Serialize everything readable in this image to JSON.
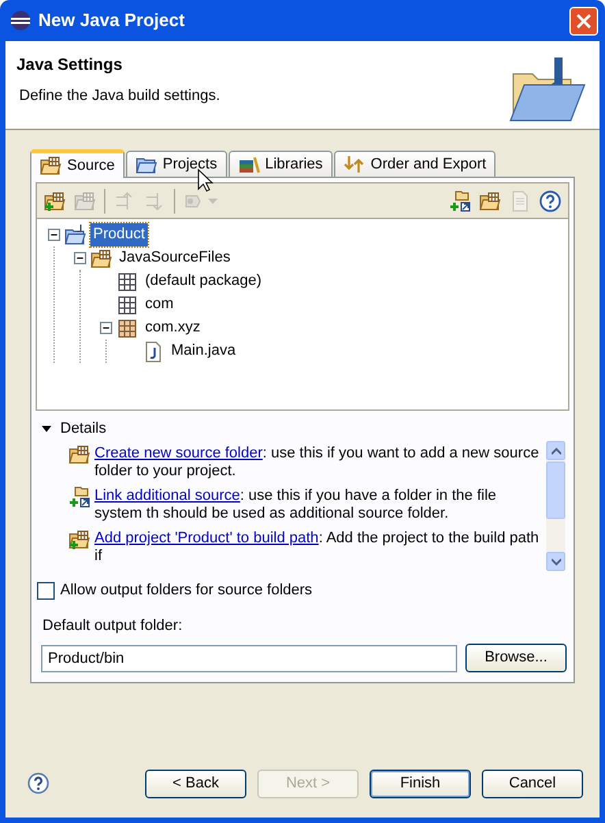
{
  "window": {
    "title": "New Java Project"
  },
  "header": {
    "title": "Java Settings",
    "description": "Define the Java build settings."
  },
  "tabs": [
    {
      "label": "Source",
      "kind": "source",
      "selected": true
    },
    {
      "label": "Projects",
      "kind": "projects",
      "selected": false
    },
    {
      "label": "Libraries",
      "kind": "libraries",
      "selected": false
    },
    {
      "label": "Order and Export",
      "kind": "order",
      "selected": false
    }
  ],
  "toolbar": {
    "left": [
      {
        "kind": "add-folder",
        "disabled": false
      },
      {
        "kind": "remove-folder",
        "disabled": true
      },
      {
        "kind": "separator"
      },
      {
        "kind": "move-up",
        "disabled": true
      },
      {
        "kind": "move-down",
        "disabled": true
      },
      {
        "kind": "separator"
      },
      {
        "kind": "configure",
        "disabled": true
      }
    ],
    "right": [
      {
        "kind": "link-folder",
        "disabled": false
      },
      {
        "kind": "folder",
        "disabled": false
      },
      {
        "kind": "file",
        "disabled": true
      },
      {
        "kind": "help",
        "disabled": false
      }
    ]
  },
  "tree": [
    {
      "label": "Product",
      "kind": "project",
      "selected": true,
      "expanded": true,
      "children": [
        {
          "label": "JavaSourceFiles",
          "kind": "source-folder",
          "selected": false,
          "expanded": true,
          "children": [
            {
              "label": "(default package)",
              "kind": "empty-package",
              "selected": false
            },
            {
              "label": "com",
              "kind": "empty-package",
              "selected": false
            },
            {
              "label": "com.xyz",
              "kind": "package",
              "selected": false,
              "expanded": true,
              "children": [
                {
                  "label": "Main.java",
                  "kind": "java-file",
                  "selected": false
                }
              ]
            }
          ]
        }
      ]
    }
  ],
  "details": {
    "label": "Details",
    "expanded": true,
    "items": [
      {
        "kind": "new-folder",
        "link": "Create new source folder",
        "text": ": use this if you want to add a new source folder to your project."
      },
      {
        "kind": "link-folder",
        "link": "Link additional source",
        "text": ": use this if you have a folder in the file system th should be used as additional source folder."
      },
      {
        "kind": "add-project",
        "link": "Add project 'Product' to build path",
        "text": ": Add the project to the build path if"
      }
    ]
  },
  "checkbox": {
    "label": "Allow output folders for source folders",
    "checked": false
  },
  "output": {
    "label": "Default output folder:",
    "value": "Product/bin",
    "button": "Browse..."
  },
  "buttons": [
    {
      "label": "< Back",
      "disabled": false,
      "default": false
    },
    {
      "label": "Next >",
      "disabled": true,
      "default": false
    },
    {
      "label": "Finish",
      "disabled": false,
      "default": true
    },
    {
      "label": "Cancel",
      "disabled": false,
      "default": false
    }
  ]
}
